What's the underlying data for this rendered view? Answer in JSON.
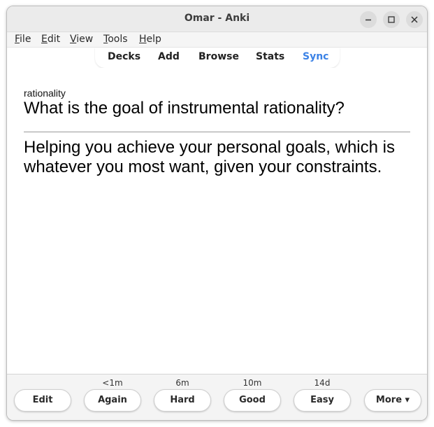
{
  "window": {
    "title": "Omar - Anki"
  },
  "menu": {
    "items": [
      {
        "label": "File"
      },
      {
        "label": "Edit"
      },
      {
        "label": "View"
      },
      {
        "label": "Tools"
      },
      {
        "label": "Help"
      }
    ]
  },
  "toolbar": {
    "items": [
      {
        "label": "Decks"
      },
      {
        "label": "Add"
      },
      {
        "label": "Browse"
      },
      {
        "label": "Stats"
      },
      {
        "label": "Sync",
        "color": "#3b82e6"
      }
    ]
  },
  "card": {
    "tag": "rationality",
    "question": "What is the goal of instrumental rationality?",
    "answer": "Helping you achieve your personal goals, which is whatever you most want, given your constraints."
  },
  "bottom": {
    "edit_label": "Edit",
    "answers": [
      {
        "label": "Again",
        "interval": "<1m"
      },
      {
        "label": "Hard",
        "interval": "6m"
      },
      {
        "label": "Good",
        "interval": "10m"
      },
      {
        "label": "Easy",
        "interval": "14d"
      }
    ],
    "more_label": "More ▾"
  },
  "icons": {
    "minimize": "minimize-icon",
    "maximize": "maximize-icon",
    "close": "close-icon"
  }
}
